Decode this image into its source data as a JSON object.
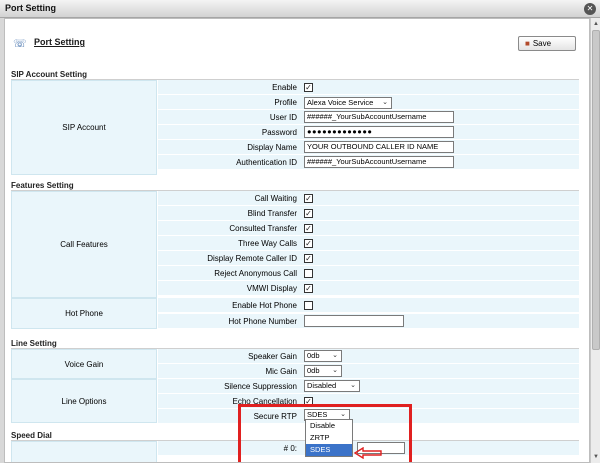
{
  "window": {
    "title": "Port Setting"
  },
  "header": {
    "page_title": "Port Setting",
    "save_label": "Save"
  },
  "sip_account": {
    "section_title": "SIP Account Setting",
    "group_label": "SIP Account",
    "rows": [
      {
        "label": "Enable",
        "type": "checkbox",
        "checked": true
      },
      {
        "label": "Profile",
        "type": "select",
        "value": "Alexa Voice Service"
      },
      {
        "label": "User ID",
        "type": "text",
        "value": "######_YourSubAccountUsername"
      },
      {
        "label": "Password",
        "type": "password",
        "value": "●●●●●●●●●●●●●"
      },
      {
        "label": "Display Name",
        "type": "text",
        "value": "YOUR OUTBOUND CALLER ID NAME"
      },
      {
        "label": "Authentication ID",
        "type": "text",
        "value": "######_YourSubAccountUsername"
      }
    ]
  },
  "features": {
    "section_title": "Features Setting",
    "call_features_label": "Call Features",
    "call_features": [
      {
        "label": "Call Waiting",
        "checked": true
      },
      {
        "label": "Blind Transfer",
        "checked": true
      },
      {
        "label": "Consulted Transfer",
        "checked": true
      },
      {
        "label": "Three Way Calls",
        "checked": true
      },
      {
        "label": "Display Remote Caller ID",
        "checked": true
      },
      {
        "label": "Reject Anonymous Call",
        "checked": false
      },
      {
        "label": "VMWI Display",
        "checked": true
      }
    ],
    "hot_phone_label": "Hot Phone",
    "hot_phone": {
      "enable_label": "Enable Hot Phone",
      "enable_checked": false,
      "number_label": "Hot Phone Number",
      "number_value": ""
    }
  },
  "line": {
    "section_title": "Line Setting",
    "voice_gain_label": "Voice Gain",
    "speaker_gain_label": "Speaker Gain",
    "speaker_gain_value": "0db",
    "mic_gain_label": "Mic Gain",
    "mic_gain_value": "0db",
    "line_options_label": "Line Options",
    "silence_label": "Silence Suppression",
    "silence_value": "Disabled",
    "echo_label": "Echo Cancellation",
    "echo_checked": true,
    "secure_rtp_label": "Secure RTP",
    "secure_rtp_value": "SDES",
    "secure_rtp_options": [
      "Disable",
      "ZRTP",
      "SDES"
    ]
  },
  "speed_dial": {
    "section_title": "Speed Dial",
    "first_label": "# 0:"
  },
  "colors": {
    "row_bg": "#eaf6fb",
    "highlight": "#e02020",
    "selected_option": "#3b73c9"
  }
}
